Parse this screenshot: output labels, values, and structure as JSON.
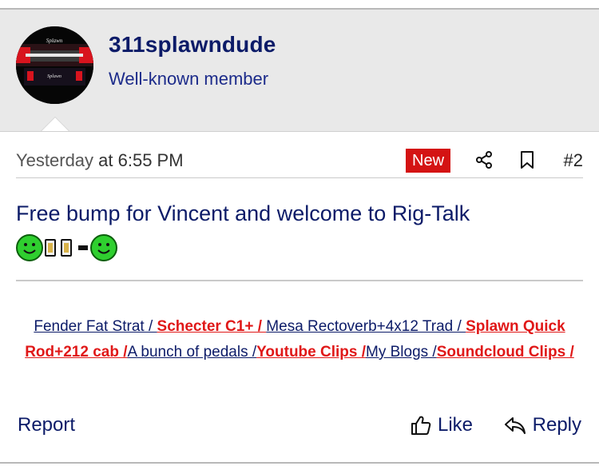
{
  "post": {
    "author": {
      "username": "311splawndude",
      "title": "Well-known member",
      "avatar_text_top": "Splawn",
      "avatar_text_bottom": "Splawn"
    },
    "meta": {
      "date_day": "Yesterday",
      "date_rest": " at 6:55 PM",
      "badge": "New",
      "post_number": "#2",
      "share_icon": "share-icon",
      "bookmark_icon": "bookmark-icon"
    },
    "message": {
      "text_link": "Free bump",
      "text_rest": " for Vincent and welcome to Rig-Talk"
    },
    "signature": {
      "items": [
        {
          "text": "Fender Fat Strat / ",
          "style": "blue"
        },
        {
          "text": "Schecter C1+ / ",
          "style": "red"
        },
        {
          "text": "Mesa Rectoverb+4x12 Trad / ",
          "style": "blue"
        },
        {
          "text": "Splawn Quick Rod+212 cab /",
          "style": "red"
        },
        {
          "text": "A bunch of pedals /",
          "style": "blue"
        },
        {
          "text": "Youtube Clips /",
          "style": "red"
        },
        {
          "text": "My Blogs /",
          "style": "blue"
        },
        {
          "text": "Soundcloud Clips /",
          "style": "red"
        }
      ]
    },
    "actions": {
      "report": "Report",
      "like": "Like",
      "reply": "Reply"
    }
  },
  "colors": {
    "accent_blue": "#0c1b68",
    "badge_red": "#d41313",
    "signature_red": "#e01818"
  }
}
